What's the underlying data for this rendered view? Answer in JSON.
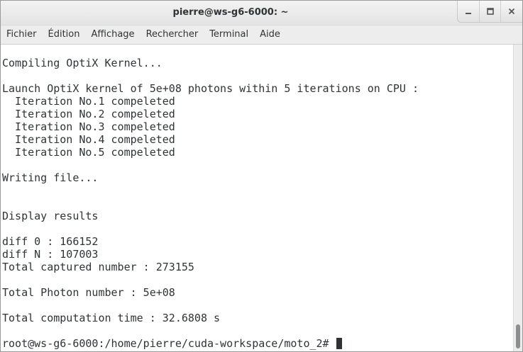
{
  "window": {
    "title": "pierre@ws-g6-6000: ~",
    "buttons": [
      "minimize-icon",
      "maximize-icon",
      "close-icon"
    ]
  },
  "menu": {
    "items": [
      "Fichier",
      "Édition",
      "Affichage",
      "Rechercher",
      "Terminal",
      "Aide"
    ]
  },
  "terminal": {
    "lines": [
      "Compiling OptiX Kernel...",
      "",
      "Launch OptiX kernel of 5e+08 photons within 5 iterations on CPU :",
      "  Iteration No.1 compeleted",
      "  Iteration No.2 compeleted",
      "  Iteration No.3 compeleted",
      "  Iteration No.4 compeleted",
      "  Iteration No.5 compeleted",
      "",
      "Writing file...",
      "",
      "",
      "Display results",
      "",
      "diff 0 : 166152",
      "diff N : 107003",
      "Total captured number : 273155",
      "",
      "Total Photon number : 5e+08",
      "",
      "Total computation time : 32.6808 s",
      "",
      "root@ws-g6-6000:/home/pierre/cuda-workspace/moto_2# "
    ]
  },
  "colors": {
    "text": "#2e3436",
    "background": "#ffffff",
    "chrome": "#ededed"
  }
}
